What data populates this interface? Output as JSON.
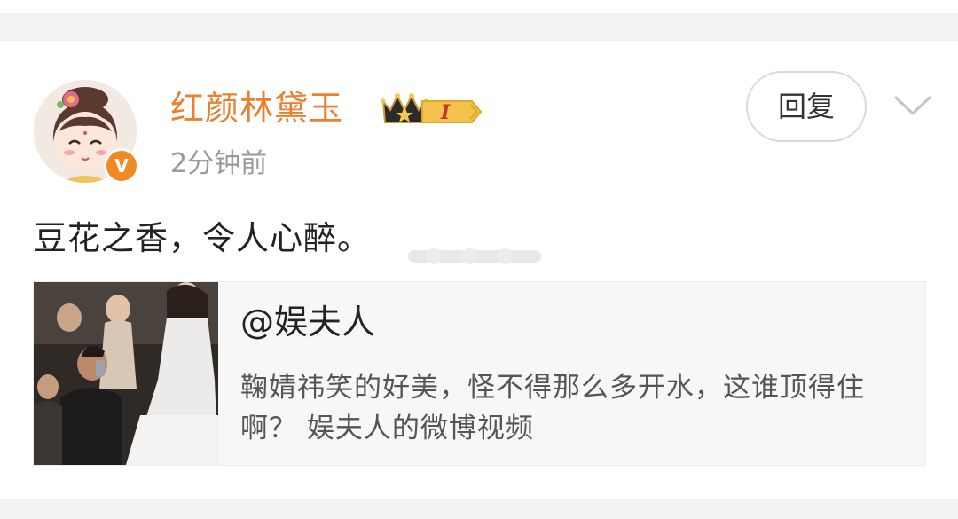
{
  "post": {
    "username": "红颜林黛玉",
    "level_badge": "I",
    "verified_mark": "V",
    "timestamp": "2分钟前",
    "reply_label": "回复",
    "text": "豆花之香，令人心醉。",
    "repost": {
      "author": "@娱夫人",
      "text": "鞠婧祎笑的好美，怪不得那么多开水，这谁顶得住啊？ 娱夫人的微博视频"
    }
  },
  "colors": {
    "username": "#eb7f2f",
    "verified_badge": "#f08a24",
    "page_bg": "#f2f2f2",
    "card_bg": "#ffffff",
    "repost_bg": "#f7f7f7"
  },
  "icons": {
    "verified": "verified-icon",
    "level": "crown-level-icon",
    "more": "chevron-down-icon"
  }
}
